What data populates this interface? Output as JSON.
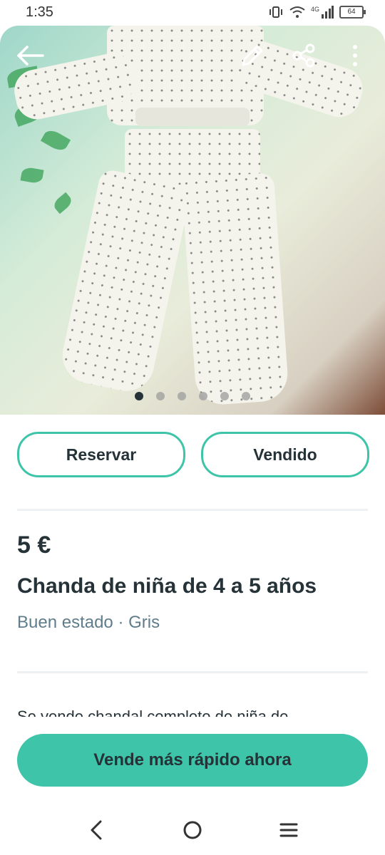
{
  "status_bar": {
    "time": "1:35",
    "network": "4G",
    "battery": "64"
  },
  "photo": {
    "image_count": 6,
    "active_index": 0,
    "icons": [
      "back-arrow-icon",
      "edit-pencil-icon",
      "share-icon",
      "more-vertical-icon"
    ]
  },
  "actions": {
    "reserve_label": "Reservar",
    "sold_label": "Vendido"
  },
  "listing": {
    "price": "5 €",
    "title": "Chanda de niña de 4 a 5 años",
    "condition_color": "Buen estado · Gris",
    "description_preview": "Se vende chandal completo de niña de"
  },
  "cta": {
    "label": "Vende más rápido ahora"
  },
  "colors": {
    "accent": "#3ec4a8",
    "text": "#253238",
    "muted": "#607d8b"
  }
}
